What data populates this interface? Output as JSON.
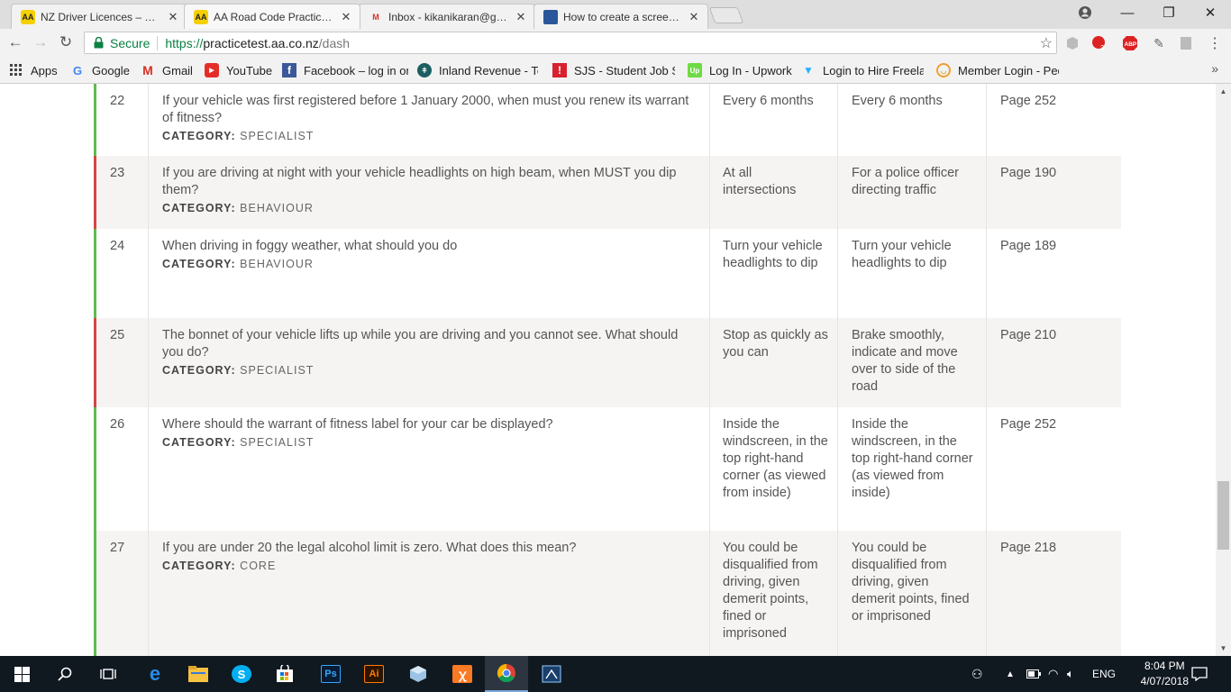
{
  "browser": {
    "tabs": [
      {
        "title": "NZ Driver Licences – How",
        "icon": "aa-logo-icon"
      },
      {
        "title": "AA Road Code Practice Te",
        "icon": "aa-logo-icon"
      },
      {
        "title": "Inbox - kikanikaran@gma",
        "icon": "gmail-icon"
      },
      {
        "title": "How to create a screensh",
        "icon": "doc-icon"
      }
    ],
    "secure_label": "Secure",
    "url": {
      "scheme": "https://",
      "host": "practicetest.aa.co.nz",
      "path": "/dash"
    },
    "ext_badge": "3",
    "abp_label": "ABP",
    "bookmarks": [
      {
        "label": "Apps",
        "icon": "apps-grid-icon"
      },
      {
        "label": "Google",
        "icon": "google-icon"
      },
      {
        "label": "Gmail",
        "icon": "gmail-icon"
      },
      {
        "label": "YouTube",
        "icon": "youtube-icon"
      },
      {
        "label": "Facebook – log in or",
        "icon": "facebook-icon"
      },
      {
        "label": "Inland Revenue - Te",
        "icon": "ird-icon"
      },
      {
        "label": "SJS - Student Job Se",
        "icon": "sjs-icon"
      },
      {
        "label": "Log In - Upwork",
        "icon": "upwork-icon"
      },
      {
        "label": "Login to Hire Freelar",
        "icon": "freelancer-icon"
      },
      {
        "label": "Member Login - Pec",
        "icon": "member-icon"
      }
    ],
    "bookmarks_more": "»"
  },
  "questions": [
    {
      "num": "22",
      "question": "If your vehicle was first registered before 1 January 2000, when must you renew its warrant of fitness?",
      "category_label": "CATEGORY:",
      "category": "SPECIALIST",
      "your_answer": "Every 6 months",
      "correct_answer": "Every 6 months",
      "page": "Page 252",
      "correct": true
    },
    {
      "num": "23",
      "question": "If you are driving at night with your vehicle headlights on high beam, when MUST you dip them?",
      "category_label": "CATEGORY:",
      "category": "BEHAVIOUR",
      "your_answer": "At all intersections",
      "correct_answer": "For a police officer directing traffic",
      "page": "Page 190",
      "correct": false
    },
    {
      "num": "24",
      "question": "When driving in foggy weather, what should you do",
      "category_label": "CATEGORY:",
      "category": "BEHAVIOUR",
      "your_answer": "Turn your vehicle headlights to dip",
      "correct_answer": "Turn your vehicle headlights to dip",
      "page": "Page 189",
      "correct": true
    },
    {
      "num": "25",
      "question": "The bonnet of your vehicle lifts up while you are driving and you cannot see. What should you do?",
      "category_label": "CATEGORY:",
      "category": "SPECIALIST",
      "your_answer": "Stop as quickly as you can",
      "correct_answer": "Brake smoothly, indicate and move over to side of the road",
      "page": "Page 210",
      "correct": false
    },
    {
      "num": "26",
      "question": "Where should the warrant of fitness label for your car be displayed?",
      "category_label": "CATEGORY:",
      "category": "SPECIALIST",
      "your_answer": "Inside the windscreen, in the top right-hand corner (as viewed from inside)",
      "correct_answer": "Inside the windscreen, in the top right-hand corner (as viewed from inside)",
      "page": "Page 252",
      "correct": true
    },
    {
      "num": "27",
      "question": "If you are under 20 the legal alcohol limit is zero. What does this mean?",
      "category_label": "CATEGORY:",
      "category": "CORE",
      "your_answer": "You could be disqualified from driving, given demerit points, fined or imprisoned",
      "correct_answer": "You could be disqualified from driving, given demerit points, fined or imprisoned",
      "page": "Page 218",
      "correct": true
    }
  ],
  "colors": {
    "correct_bar": "#63b94f",
    "incorrect_bar": "#d44546",
    "alt_row": "#f5f4f2"
  },
  "taskbar": {
    "apps": [
      "start-icon",
      "search-icon",
      "task-view-icon",
      "edge-icon",
      "file-explorer-icon",
      "skype-icon",
      "store-icon",
      "photoshop-icon",
      "illustrator-icon",
      "virtualbox-icon",
      "xampp-icon",
      "chrome-icon",
      "snipping-icon"
    ],
    "ps_label": "Ps",
    "ai_label": "Ai",
    "language": "ENG",
    "time": "8:04 PM",
    "date": "4/07/2018"
  }
}
